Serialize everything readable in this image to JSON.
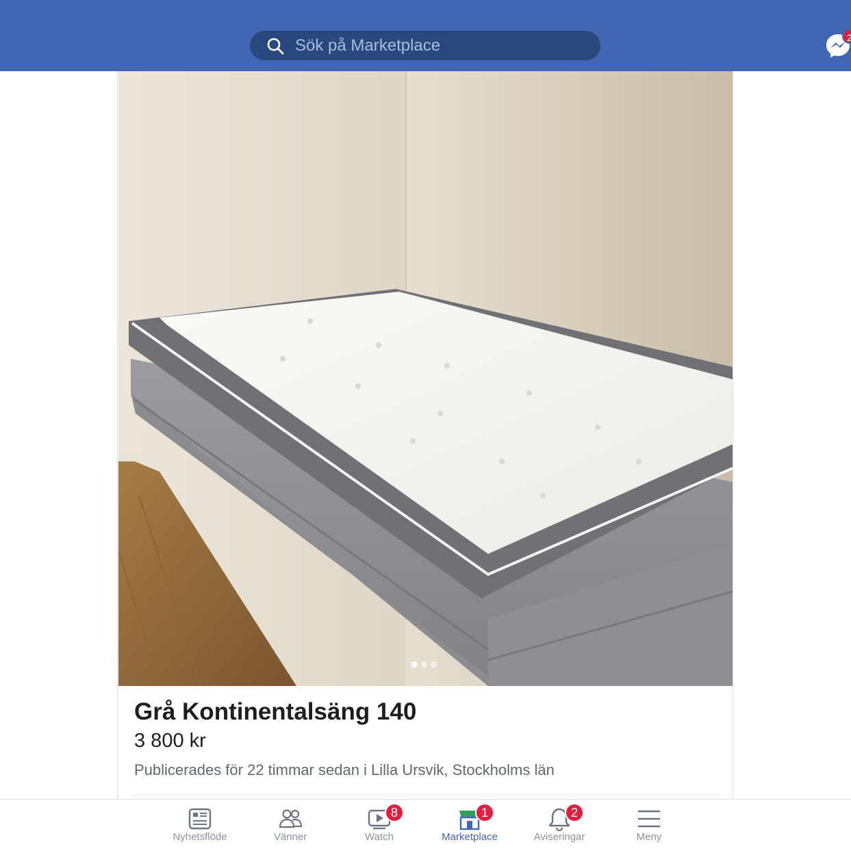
{
  "search": {
    "placeholder": "Sök på Marketplace",
    "icon": "search-icon"
  },
  "header": {
    "messenger_icon": "messenger-icon",
    "messenger_badge": "2"
  },
  "listing": {
    "title": "Grå Kontinentalsäng 140",
    "price": "3 800 kr",
    "posted": "Publicerades för 22 timmar sedan i Lilla Ursvik, Stockholms län",
    "photo_count": 3,
    "current_photo": 1
  },
  "nav": {
    "items": [
      {
        "label": "Nyhetsflöde",
        "icon": "news-feed-icon",
        "badge": "",
        "active": false
      },
      {
        "label": "Vänner",
        "icon": "friends-icon",
        "badge": "",
        "active": false
      },
      {
        "label": "Watch",
        "icon": "watch-icon",
        "badge": "8",
        "active": false
      },
      {
        "label": "Marketplace",
        "icon": "marketplace-icon",
        "badge": "1",
        "active": true
      },
      {
        "label": "Aviseringar",
        "icon": "bell-icon",
        "badge": "2",
        "active": false
      },
      {
        "label": "Meny",
        "icon": "menu-icon",
        "badge": "",
        "active": false
      }
    ]
  },
  "colors": {
    "brand": "#4267b2",
    "badge": "#e41e3f",
    "search_bg": "#29487d"
  }
}
